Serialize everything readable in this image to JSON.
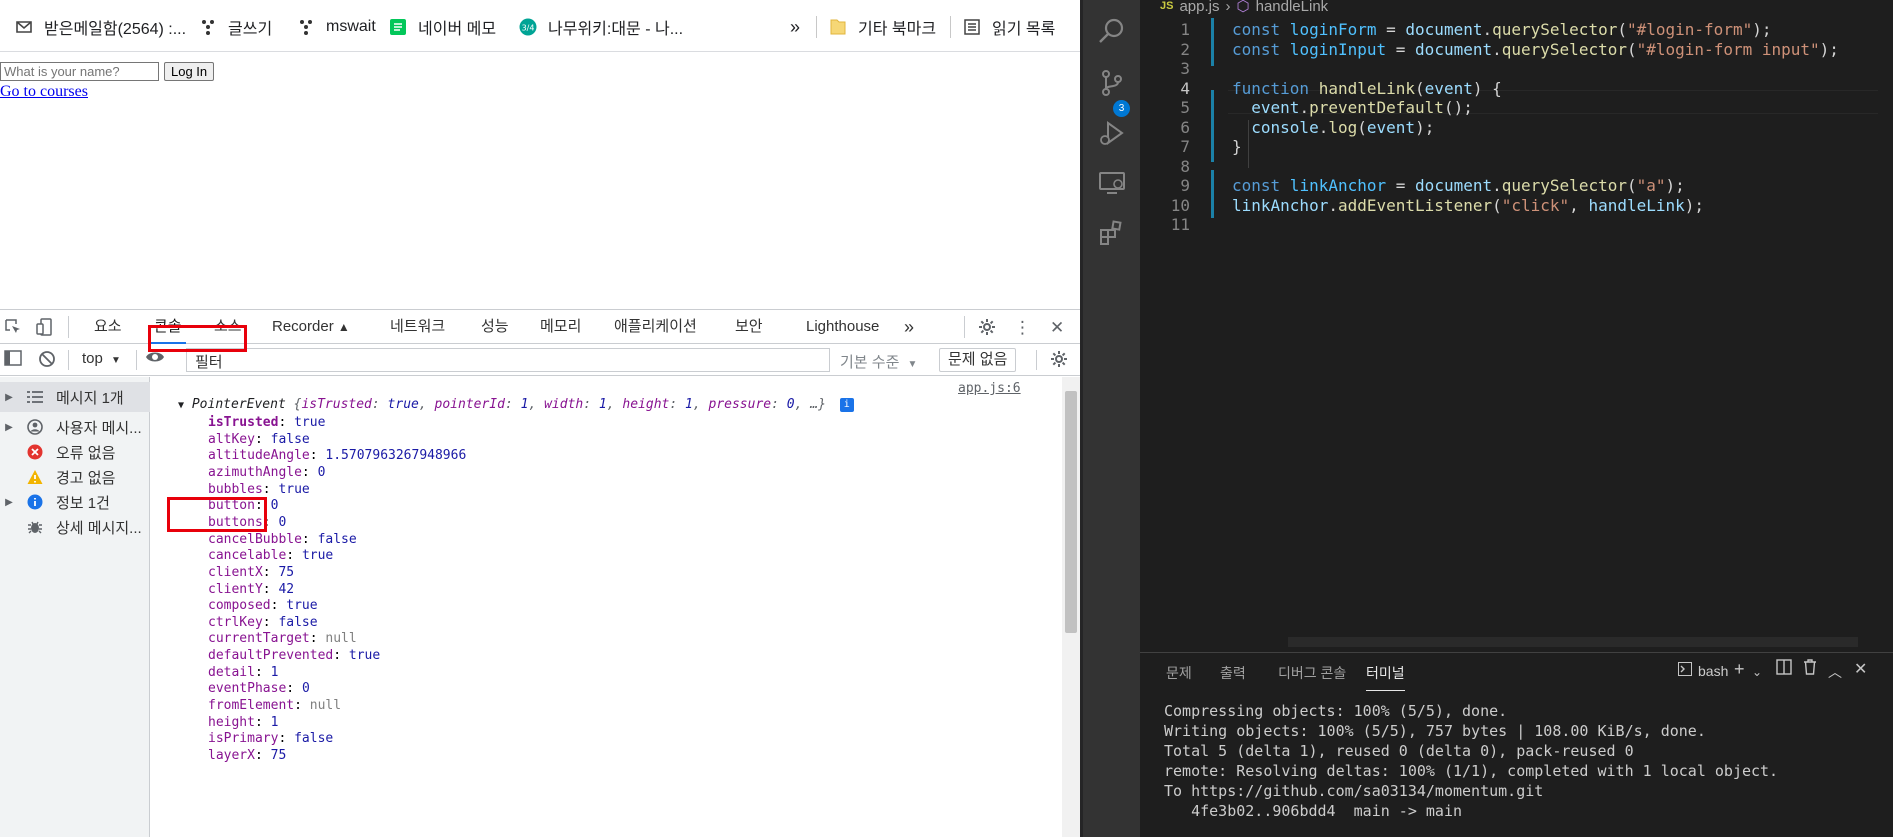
{
  "browser": {
    "bookmarks": [
      {
        "label": "받은메일함(2564) :...",
        "icon": "mail-icon"
      },
      {
        "label": "글쓰기",
        "icon": "dots-icon"
      },
      {
        "label": "mswait",
        "icon": "dots-icon"
      },
      {
        "label": "네이버 메모",
        "icon": "memo-icon"
      },
      {
        "label": "나무위키:대문 - 나...",
        "icon": "namu-icon"
      }
    ],
    "bookmarks_overflow": "»",
    "other_bookmarks": "기타 북마크",
    "reading_list": "읽기 목록",
    "page": {
      "name_placeholder": "What is your name?",
      "login_button": "Log In",
      "link_text": "Go to courses"
    }
  },
  "devtools": {
    "tabs": [
      "요소",
      "콘솔",
      "소스",
      "Recorder",
      "네트워크",
      "성능",
      "메모리",
      "애플리케이션",
      "보안",
      "Lighthouse"
    ],
    "active_tab": "콘솔",
    "more_tabs": "»",
    "context": "top",
    "filter_placeholder": "필터",
    "level": "기본 수준",
    "issues": "문제 없음",
    "sidebar": [
      {
        "label": "메시지 1개",
        "icon": "list-icon",
        "expandable": true
      },
      {
        "label": "사용자 메시...",
        "icon": "user-icon",
        "expandable": true
      },
      {
        "label": "오류 없음",
        "icon": "error-icon",
        "expandable": false
      },
      {
        "label": "경고 없음",
        "icon": "warning-icon",
        "expandable": false
      },
      {
        "label": "정보 1건",
        "icon": "info-icon",
        "expandable": true
      },
      {
        "label": "상세 메시지...",
        "icon": "bug-icon",
        "expandable": false
      }
    ],
    "console": {
      "source": "app.js:6",
      "object_class": "PointerEvent",
      "preview_parts": [
        "{",
        "isTrusted",
        ": ",
        "true",
        ", ",
        "pointerId",
        ": ",
        "1",
        ", ",
        "width",
        ": ",
        "1",
        ", ",
        "height",
        ": ",
        "1",
        ", ",
        "pressure",
        ": ",
        "0",
        ", …}"
      ],
      "properties": [
        {
          "key": "isTrusted",
          "value": "true",
          "type": "true",
          "bold": true
        },
        {
          "key": "altKey",
          "value": "false",
          "type": "false"
        },
        {
          "key": "altitudeAngle",
          "value": "1.5707963267948966",
          "type": "num"
        },
        {
          "key": "azimuthAngle",
          "value": "0",
          "type": "num"
        },
        {
          "key": "bubbles",
          "value": "true",
          "type": "true"
        },
        {
          "key": "button",
          "value": "0",
          "type": "num"
        },
        {
          "key": "buttons",
          "value": "0",
          "type": "num"
        },
        {
          "key": "cancelBubble",
          "value": "false",
          "type": "false"
        },
        {
          "key": "cancelable",
          "value": "true",
          "type": "true"
        },
        {
          "key": "clientX",
          "value": "75",
          "type": "num"
        },
        {
          "key": "clientY",
          "value": "42",
          "type": "num"
        },
        {
          "key": "composed",
          "value": "true",
          "type": "true"
        },
        {
          "key": "ctrlKey",
          "value": "false",
          "type": "false"
        },
        {
          "key": "currentTarget",
          "value": "null",
          "type": "null"
        },
        {
          "key": "defaultPrevented",
          "value": "true",
          "type": "true"
        },
        {
          "key": "detail",
          "value": "1",
          "type": "num"
        },
        {
          "key": "eventPhase",
          "value": "0",
          "type": "num"
        },
        {
          "key": "fromElement",
          "value": "null",
          "type": "null"
        },
        {
          "key": "height",
          "value": "1",
          "type": "num"
        },
        {
          "key": "isPrimary",
          "value": "false",
          "type": "false"
        },
        {
          "key": "layerX",
          "value": "75",
          "type": "num"
        }
      ]
    }
  },
  "vscode": {
    "breadcrumb": {
      "lang": "JS",
      "file": "app.js",
      "symbol": "handleLink"
    },
    "scm_badge": "3",
    "code_lines": [
      [
        [
          "kw",
          "const"
        ],
        [
          "",
          ""
        ],
        [
          "cv",
          " loginForm"
        ],
        [
          "",
          " = "
        ],
        [
          "vr",
          "document"
        ],
        [
          "",
          "."
        ],
        [
          "fn",
          "querySelector"
        ],
        [
          "",
          "("
        ],
        [
          "st",
          "\"#login-form\""
        ],
        [
          "",
          ");"
        ]
      ],
      [
        [
          "kw",
          "const"
        ],
        [
          "cv",
          " loginInput"
        ],
        [
          "",
          " = "
        ],
        [
          "vr",
          "document"
        ],
        [
          "",
          "."
        ],
        [
          "fn",
          "querySelector"
        ],
        [
          "",
          "("
        ],
        [
          "st",
          "\"#login-form input\""
        ],
        [
          "",
          ");"
        ]
      ],
      [],
      [
        [
          "kw",
          "function"
        ],
        [
          "",
          " "
        ],
        [
          "fn",
          "handleLink"
        ],
        [
          "",
          "("
        ],
        [
          "vr",
          "event"
        ],
        [
          "",
          ") {"
        ]
      ],
      [
        [
          "",
          ""
        ],
        [
          "vr",
          "  event"
        ],
        [
          "",
          "."
        ],
        [
          "fn",
          "preventDefault"
        ],
        [
          "",
          "();"
        ]
      ],
      [
        [
          "vr",
          "  console"
        ],
        [
          "",
          "."
        ],
        [
          "fn",
          "log"
        ],
        [
          "",
          "("
        ],
        [
          "vr",
          "event"
        ],
        [
          "",
          ");"
        ]
      ],
      [
        [
          "",
          "}"
        ]
      ],
      [],
      [
        [
          "kw",
          "const"
        ],
        [
          "cv",
          " linkAnchor"
        ],
        [
          "",
          " = "
        ],
        [
          "vr",
          "document"
        ],
        [
          "",
          "."
        ],
        [
          "fn",
          "querySelector"
        ],
        [
          "",
          "("
        ],
        [
          "st",
          "\"a\""
        ],
        [
          "",
          ");"
        ]
      ],
      [
        [
          "vr",
          "linkAnchor"
        ],
        [
          "",
          "."
        ],
        [
          "fn",
          "addEventListener"
        ],
        [
          "",
          "("
        ],
        [
          "st",
          "\"click\""
        ],
        [
          "",
          ", "
        ],
        [
          "vr",
          "handleLink"
        ],
        [
          "",
          ");"
        ]
      ],
      []
    ],
    "current_line": 4,
    "panel_tabs": [
      "문제",
      "출력",
      "디버그 콘솔",
      "터미널"
    ],
    "active_panel_tab": "터미널",
    "terminal_name": "bash",
    "terminal_lines": [
      "Compressing objects: 100% (5/5), done.",
      "Writing objects: 100% (5/5), 757 bytes | 108.00 KiB/s, done.",
      "Total 5 (delta 1), reused 0 (delta 0), pack-reused 0",
      "remote: Resolving deltas: 100% (1/1), completed with 1 local object.",
      "To https://github.com/sa03134/momentum.git",
      "   4fe3b02..906bdd4  main -> main"
    ]
  },
  "colors": {
    "highlight_box": "#e8000b",
    "link": "#0000ee",
    "vscode_bg": "#1e1e1e",
    "active_tab_underline": "#1a73e8"
  }
}
